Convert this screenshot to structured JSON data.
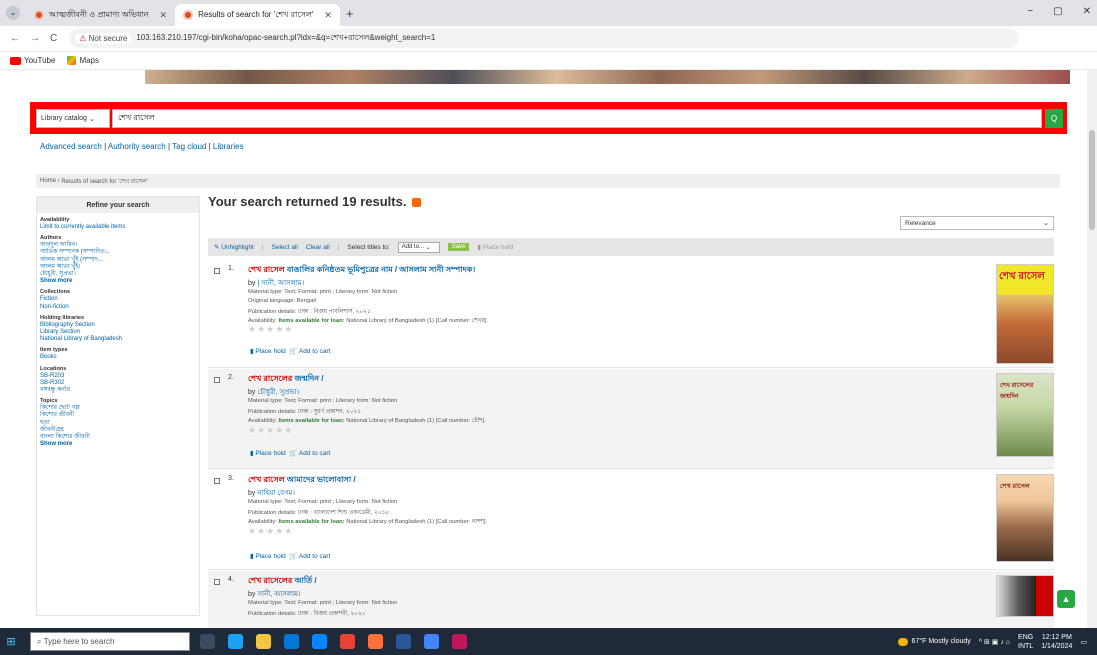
{
  "browser": {
    "tabs": [
      {
        "title": "আত্মজীবনী ও প্রামাণ্য অভিধান",
        "active": false
      },
      {
        "title": "Results of search for 'শেখ রাসেল'",
        "active": true
      }
    ],
    "new_tab_glyph": "+",
    "window_controls": [
      "−",
      "▢",
      "✕"
    ],
    "nav": {
      "back": "←",
      "forward": "→",
      "reload": "C"
    },
    "not_secure": "Not secure",
    "url": "103.163.210.197/cgi-bin/koha/opac-search.pl?idx=&q=শেখ+রাসেল&weight_search=1",
    "bookmarks": [
      "YouTube",
      "Maps"
    ]
  },
  "search": {
    "scope": "Library catalog",
    "query": "শেখ রাসেল",
    "go_glyph": "Q"
  },
  "top_links": [
    "Advanced search",
    "Authority search",
    "Tag cloud",
    "Libraries"
  ],
  "breadcrumb": {
    "home": "Home",
    "current": "Results of search for 'শেখ রাসেল'"
  },
  "sidebar": {
    "title": "Refine your search",
    "facets": [
      {
        "title": "Availability",
        "items": [
          "Limit to currently available items"
        ],
        "more": ""
      },
      {
        "title": "Authors",
        "items": [
          "আবদুল আমিন।",
          "আতিক সম্পাদক (সম্পাদিত...",
          "আলম আতা খুঁই (সম্পাদ...",
          "আলম আতা খুঁই।",
          "চৌধুরী, সুপ্রভা।"
        ],
        "more": "Show more"
      },
      {
        "title": "Collections",
        "items": [
          "Fiction",
          "Non-fiction"
        ],
        "more": ""
      },
      {
        "title": "Holding libraries",
        "items": [
          "Bibliography Section",
          "Library Section",
          "National Library of Bangladesh"
        ],
        "more": ""
      },
      {
        "title": "Item types",
        "items": [
          "Books"
        ],
        "more": ""
      },
      {
        "title": "Locations",
        "items": [
          "SB-R203",
          "SB-R302",
          "বঙ্গবন্ধু কর্নার"
        ],
        "more": ""
      },
      {
        "title": "Topics",
        "items": [
          "কিশোর ছোট গল্প",
          "কিশোর জীবনী",
          "ছড়া",
          "জীবনীগ্রন্থ",
          "বাংলা কিশোর জীবনী"
        ],
        "more": "Show more"
      }
    ]
  },
  "results_header": {
    "text": "Your search returned 19 results.",
    "sort": "Relevance"
  },
  "toolbar": {
    "unhighlight": "Unhighlight",
    "select_all": "Select all",
    "clear_all": "Clear all",
    "select_titles": "Select titles to:",
    "add_to": "Add to...",
    "save": "Save",
    "place_hold": "Place hold"
  },
  "results": [
    {
      "num": "1.",
      "title_hl": "শেখ রাসেল",
      "title_rest": " বাঙালির কনিষ্ঠতম ভূমিপুত্রের নাম / আসলাম সানী সম্পাদক।",
      "by": "by",
      "author": "| সানী, আসলাম।",
      "material": "Material type:  Text; Format: print ; Literary form: Not fiction",
      "lang": "Original language: Bengali",
      "pub": "Publication details: ঢাকা : বিজয় পাবলিশার্স, ২০২১",
      "avail_label": "Availability:",
      "avail_ok": "Items available for loan:",
      "avail_rest": " National Library of Bangladesh (1) [Call number: শেখর].",
      "stars": "★★★★★",
      "place_hold": "Place hold",
      "add_cart": "Add to cart",
      "cover_text": "শেখ রাসেল"
    },
    {
      "num": "2.",
      "title_hl": "শেখ রাসেলের",
      "title_rest": " জন্মদিন /",
      "by": "by",
      "author": "চৌধুরী, সুপ্রভা।",
      "material": "Material type:  Text; Format: print ; Literary form: Not fiction",
      "lang": "",
      "pub": "Publication details: ঢাকা : সুবর্ণ প্রকাশন, ২০২১",
      "avail_label": "Availability:",
      "avail_ok": "Items available for loan:",
      "avail_rest": " National Library of Bangladesh (1) [Call number: চৌশ].",
      "stars": "★★★★★",
      "place_hold": "Place hold",
      "add_cart": "Add to cart",
      "cover_text": "শেখ রাসেলের জন্মদিন"
    },
    {
      "num": "3.",
      "title_hl": "শেখ রাসেল",
      "title_rest": " আমাদের ভালোবাসা /",
      "by": "by",
      "author": "নাহিয়া বেগম।",
      "material": "Material type:  Text; Format: print ; Literary form: Not fiction",
      "lang": "",
      "pub": "Publication details: ঢাকা : বাংলাদেশ শিশু একাডেমী, ২০১৮",
      "avail_label": "Availability:",
      "avail_ok": "Items available for loan:",
      "avail_rest": " National Library of Bangladesh (1) [Call number: নাশশ].",
      "stars": "★★★★★",
      "place_hold": "Place hold",
      "add_cart": "Add to cart",
      "cover_text": "শেখ রাসেল"
    },
    {
      "num": "4.",
      "title_hl": "শেখ রাসেলের",
      "title_rest": " আর্তি /",
      "by": "by",
      "author": "সানী, আসলাম।",
      "material": "Material type:  Text; Format: print ; Literary form: Not fiction",
      "lang": "",
      "pub": "Publication details: ঢাকা : বিজয় প্রকাশনী, ২০২০",
      "avail_label": "",
      "avail_ok": "",
      "avail_rest": "",
      "stars": "",
      "place_hold": "",
      "add_cart": "",
      "cover_text": ""
    }
  ],
  "taskbar": {
    "search_placeholder": "Type here to search",
    "weather": "67°F  Mostly cloudy",
    "lang": "ENG",
    "lang2": "INTL",
    "time": "12:12 PM",
    "date": "1/14/2024"
  },
  "colors": {
    "search_band": "#ff0000",
    "go_button": "#28a745",
    "link": "#0063a6",
    "title_highlight": "#c00000"
  }
}
